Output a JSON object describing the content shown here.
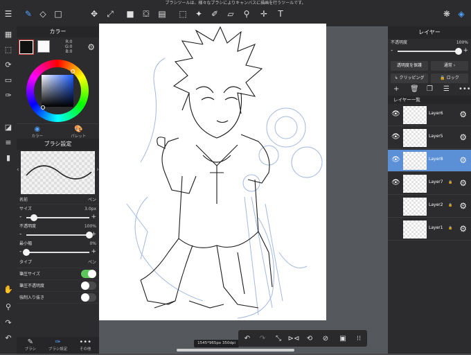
{
  "tip_text": "ブラシツールは、様々なブラシによりキャンバスに描画を行うツールです。",
  "toolbar": {
    "icons": [
      "menu-icon",
      "brush-icon",
      "eraser-icon",
      "square-icon",
      "move-icon",
      "transform-icon",
      "fill-rect-icon",
      "bucket-icon",
      "gradient-icon",
      "select-rect-icon",
      "magic-wand-icon",
      "select-pen-icon",
      "select-eraser-icon",
      "eyedropper-icon",
      "text-icon",
      "materials-icon",
      "layers-icon"
    ]
  },
  "color_panel": {
    "title": "カラー",
    "rgb": [
      "R:0",
      "G:0",
      "B:0"
    ],
    "tabs": [
      "カラー",
      "パレット"
    ]
  },
  "brush_panel": {
    "title": "ブラシ設定",
    "name_label": "名前",
    "name_value": "ペン",
    "size_label": "サイズ",
    "size_value": "3.0px",
    "size_fraction": 0.12,
    "opacity_label": "不透明度",
    "opacity_value": "100%",
    "opacity_fraction": 1.0,
    "min_width_label": "最小幅",
    "min_width_value": "0%",
    "min_width_fraction": 0.0,
    "type_label": "タイプ",
    "type_value": "ペン",
    "pressure_size_label": "筆圧サイズ",
    "pressure_size_on": true,
    "pressure_opacity_label": "筆圧不透明度",
    "pressure_opacity_on": false,
    "force_taper_label": "強制入り抜き",
    "force_taper_on": false,
    "bottom_tabs": [
      "ブラシ",
      "ブラシ設定",
      "その他"
    ]
  },
  "layer_panel": {
    "title": "レイヤー",
    "opacity_label": "不透明度",
    "opacity_value": "100%",
    "protect_label": "透明度を保護",
    "blend_label": "通常",
    "clipping_label": "クリッピング",
    "lock_label": "ロック",
    "list_title": "レイヤー一覧",
    "layers": [
      {
        "name": "Layer6",
        "visible": true,
        "selected": false,
        "locked": false
      },
      {
        "name": "Layer5",
        "visible": true,
        "selected": false,
        "locked": false
      },
      {
        "name": "Layer8",
        "visible": true,
        "selected": true,
        "locked": false
      },
      {
        "name": "Layer7",
        "visible": true,
        "selected": false,
        "locked": true
      },
      {
        "name": "Layer2",
        "visible": false,
        "selected": false,
        "locked": true
      },
      {
        "name": "Layer1",
        "visible": false,
        "selected": false,
        "locked": true
      }
    ]
  },
  "status_text": "1545*965px 350dpi 186%",
  "colors": {
    "accent": "#4da3ff",
    "selected_layer": "#5b8fd6",
    "toggle_on": "#5cc85a"
  }
}
